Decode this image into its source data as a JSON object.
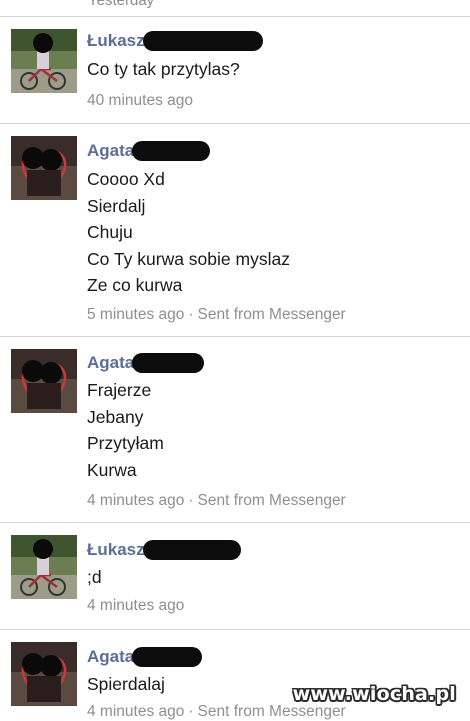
{
  "top_partial": "Yesterday",
  "messages": [
    {
      "sender": "Łukasz",
      "lines": [
        "Co ty tak przytylas?"
      ],
      "time": "40 minutes ago",
      "source": ""
    },
    {
      "sender": "Agata",
      "lines": [
        "Coooo Xd",
        "Sierdalj",
        "Chuju",
        "Co Ty kurwa sobie myslaz",
        "Ze co kurwa"
      ],
      "time": "5 minutes ago",
      "source": "Sent from Messenger"
    },
    {
      "sender": "Agata",
      "lines": [
        "Frajerze",
        "Jebany",
        "Przytyłam",
        "Kurwa"
      ],
      "time": "4 minutes ago",
      "source": "Sent from Messenger"
    },
    {
      "sender": "Łukasz",
      "lines": [
        ";d"
      ],
      "time": "4 minutes ago",
      "source": ""
    },
    {
      "sender": "Agata",
      "lines": [
        "Spierdalaj"
      ],
      "time": "4 minutes ago",
      "source": "Sent from Messenger"
    }
  ],
  "meta_separator": "·",
  "watermark": "www.wiocha.pl",
  "colors": {
    "sender_name": "#5b6e96",
    "message_text": "#1a1a1a",
    "meta_text": "#8f8f8f",
    "divider": "#d6d6d6",
    "redaction": "#0c0c0c"
  },
  "icons": {
    "lukasz_avatar": "avatar-photo-boy-bicycle",
    "agata_avatar": "avatar-photo-couple-heart"
  }
}
